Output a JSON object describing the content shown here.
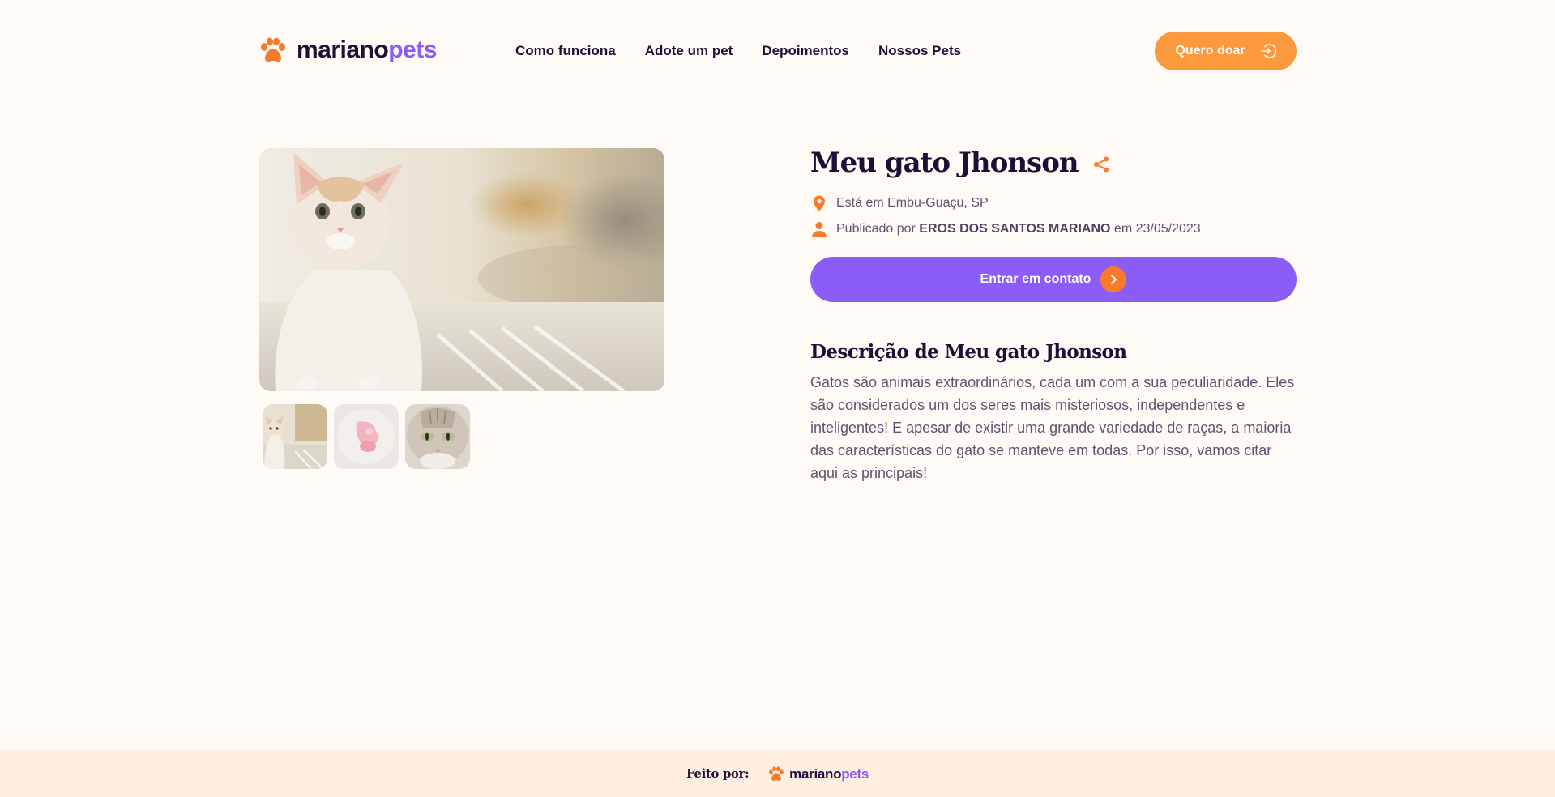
{
  "brand": {
    "name_part1": "mariano",
    "name_part2": "pets",
    "accent": "#8b5cf6",
    "orange": "#fb993c"
  },
  "nav": {
    "items": [
      {
        "label": "Como funciona"
      },
      {
        "label": "Adote um pet"
      },
      {
        "label": "Depoimentos"
      },
      {
        "label": "Nossos Pets"
      }
    ],
    "donate_label": "Quero doar",
    "donate_icon": "sign-in-icon"
  },
  "gallery": {
    "main_image": "kitten-photo",
    "thumbnails": [
      {
        "image": "kitten-thumbnail"
      },
      {
        "image": "pink-toy-thumbnail"
      },
      {
        "image": "tabby-cat-thumbnail"
      }
    ]
  },
  "pet": {
    "title": "Meu gato Jhonson",
    "share_icon": "share-icon",
    "location": "Está em Embu-Guaçu, SP",
    "published_prefix": "Publicado por",
    "author": "EROS DOS SANTOS MARIANO",
    "published_suffix": "em 23/05/2023",
    "contact_label": "Entrar em contato",
    "description_title": "Descrição de Meu gato Jhonson",
    "description": "Gatos são animais extraordinários, cada um com a sua peculiaridade. Eles são considerados um dos seres mais misteriosos, independentes e inteligentes! E apesar de existir uma grande variedade de raças, a maioria das características do gato se manteve em todas. Por isso, vamos citar aqui as principais!"
  },
  "footer": {
    "label": "Feito por:"
  }
}
